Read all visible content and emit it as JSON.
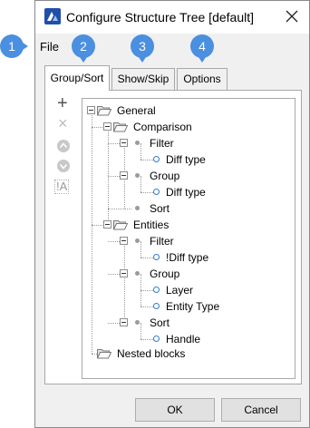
{
  "window": {
    "title": "Configure Structure Tree [default]"
  },
  "menu": {
    "file": "File"
  },
  "tabs": [
    {
      "label": "Group/Sort",
      "active": true
    },
    {
      "label": "Show/Skip",
      "active": false
    },
    {
      "label": "Options",
      "active": false
    }
  ],
  "side_buttons": {
    "add": "+",
    "remove": "×",
    "not_label": "!A"
  },
  "tree": {
    "general": "General",
    "comparison": "Comparison",
    "comparison_filter": "Filter",
    "comparison_filter_item": "Diff type",
    "comparison_group": "Group",
    "comparison_group_item": "Diff type",
    "comparison_sort": "Sort",
    "entities": "Entities",
    "entities_filter": "Filter",
    "entities_filter_item": "!Diff type",
    "entities_group": "Group",
    "entities_group_item1": "Layer",
    "entities_group_item2": "Entity Type",
    "entities_sort": "Sort",
    "entities_sort_item": "Handle",
    "nested_blocks": "Nested blocks"
  },
  "buttons": {
    "ok": "OK",
    "cancel": "Cancel"
  },
  "callouts": [
    "1",
    "2",
    "3",
    "4"
  ],
  "colors": {
    "callout": "#4a8fe0",
    "accent_ring": "#2f7ad6",
    "app_icon": "#1f4fa8"
  }
}
